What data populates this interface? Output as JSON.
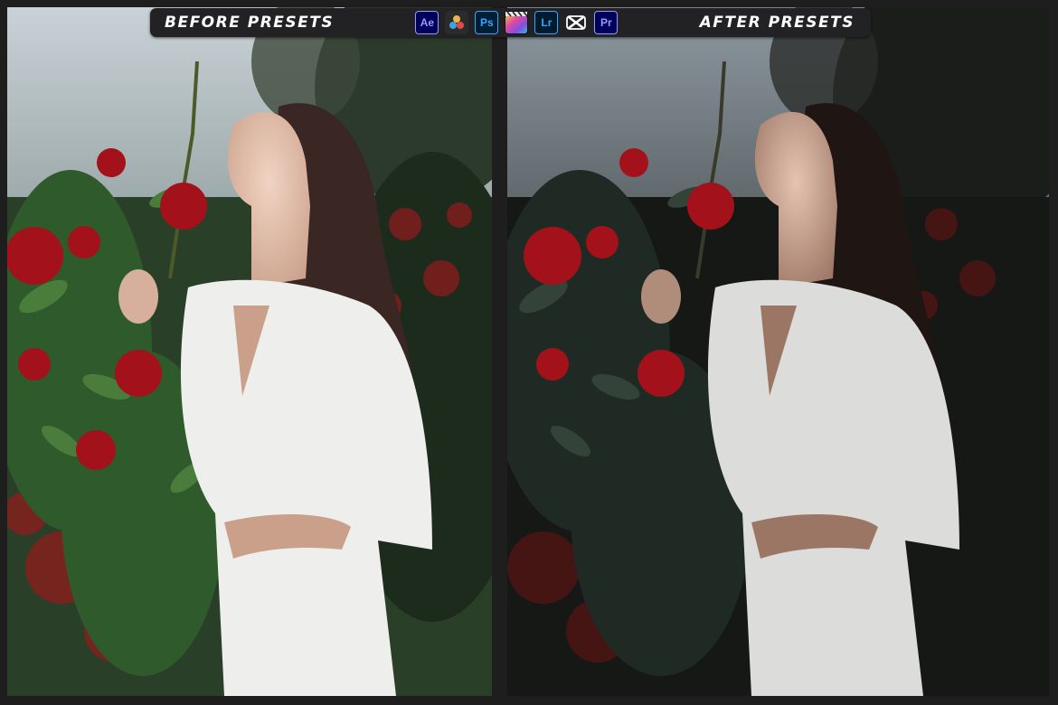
{
  "banner": {
    "before_label": "BEFORE PRESETS",
    "after_label": "AFTER PRESETS",
    "app_icons": [
      {
        "name": "after-effects-icon",
        "text": "Ae"
      },
      {
        "name": "davinci-resolve-icon",
        "text": ""
      },
      {
        "name": "photoshop-icon",
        "text": "Ps"
      },
      {
        "name": "final-cut-pro-icon",
        "text": ""
      },
      {
        "name": "lightroom-icon",
        "text": "Lr"
      },
      {
        "name": "capcut-icon",
        "text": ""
      },
      {
        "name": "premiere-pro-icon",
        "text": "Pr"
      }
    ]
  },
  "colors": {
    "background": "#1f1e1f",
    "rose_red": "#a3121a",
    "dress_white": "#eeeeec",
    "foliage_before": "#2f5a2b",
    "foliage_after": "#1f2a24"
  }
}
